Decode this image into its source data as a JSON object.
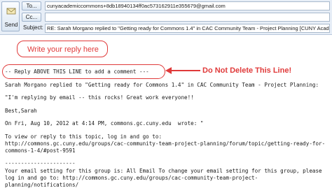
{
  "compose": {
    "send_label": "Send",
    "to_label": "To...",
    "cc_label": "Cc...",
    "subject_label": "Subject:",
    "to_value": "cunyacademiccommons+8db18940134ff0ac573162911e355679@gmail.com",
    "cc_value": "",
    "subject_value": "RE: Sarah Morgano replied to \"Getting ready for Commons 1.4\" in CAC Community Team - Project Planning [CUNY Academic Commons]"
  },
  "annotations": {
    "reply_hint": "Write your reply here",
    "do_not_delete": "Do Not Delete This Line!"
  },
  "body": {
    "separator_line": "-- Reply ABOVE THIS LINE to add a comment ---",
    "line_replied": "Sarah Morgano replied to \"Getting ready for Commons 1.4\" in CAC Community Team - Project Planning:",
    "line_quote": "\"I'm replying by email -- this rocks! Great work everyone!!",
    "line_best": "Best,Sarah",
    "line_date": "On Fri, Aug 10, 2012 at 4:14 PM, commons.gc.cuny.edu  wrote: \"",
    "line_view1": "To view or reply to this topic, log in and go to:",
    "line_view2": "http://commons.gc.cuny.edu/groups/cac-community-team-project-planning/forum/topic/getting-ready-for-",
    "line_view3": "commons-1-4/#post-9591",
    "line_dashes": "----------------------",
    "line_setting1": "Your email setting for this group is: All Email To change your email setting for this group, please",
    "line_setting2": "log in and go to: http://commons.gc.cuny.edu/groups/cac-community-team-project-",
    "line_setting3": "planning/notifications/"
  },
  "colors": {
    "annotation": "#e03a3a",
    "header_bg": "#e7eef7"
  }
}
